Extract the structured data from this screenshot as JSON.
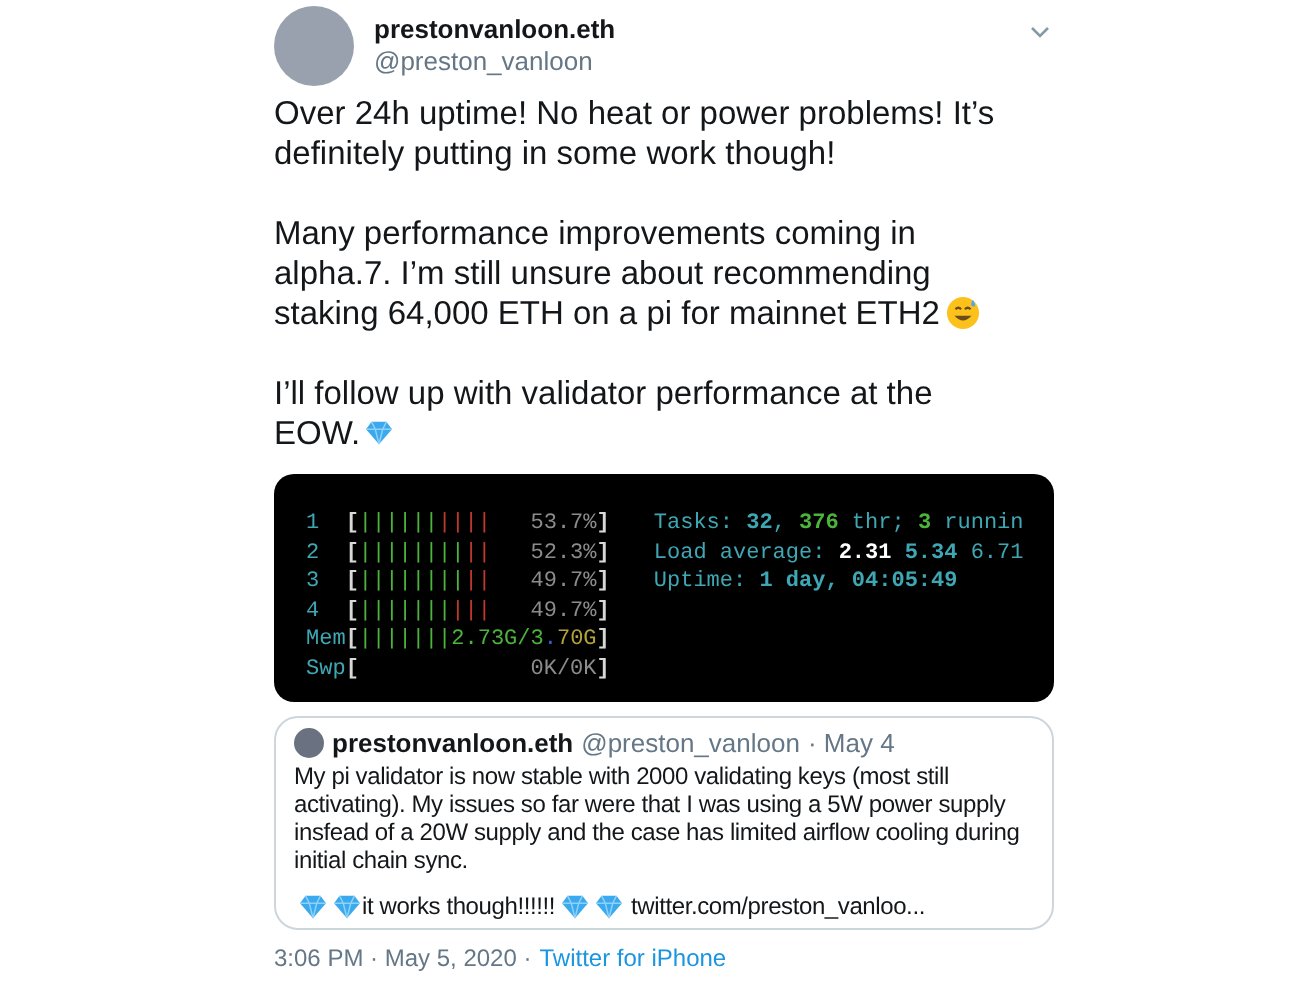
{
  "author": {
    "name": "prestonvanloon.eth",
    "handle": "@preston_vanloon"
  },
  "paragraphs": [
    {
      "text": "Over 24h uptime! No heat or power problems! It’s definitely putting in some work though!",
      "kind": "plain"
    },
    {
      "text": "Many performance improvements coming in alpha.7. I’m still unsure about recommending staking 64,000 ETH on a pi for mainnet ETH2",
      "kind": "smile"
    },
    {
      "text": "I’ll follow up with validator performance at the EOW.",
      "kind": "diamond"
    }
  ],
  "terminal": {
    "left": [
      [
        {
          "text": "1  ",
          "kind": "label"
        },
        {
          "text": "[",
          "kind": "bracket"
        },
        {
          "text": "||||||",
          "kind": "green"
        },
        {
          "text": "||||",
          "kind": "red"
        },
        {
          "text": "   53.7%",
          "kind": "dim"
        },
        {
          "text": "]",
          "kind": "bracket"
        }
      ],
      [
        {
          "text": "2  ",
          "kind": "label"
        },
        {
          "text": "[",
          "kind": "bracket"
        },
        {
          "text": "||||||||",
          "kind": "green"
        },
        {
          "text": "||",
          "kind": "red"
        },
        {
          "text": "   52.3%",
          "kind": "dim"
        },
        {
          "text": "]",
          "kind": "bracket"
        }
      ],
      [
        {
          "text": "3  ",
          "kind": "label"
        },
        {
          "text": "[",
          "kind": "bracket"
        },
        {
          "text": "||||||||",
          "kind": "green"
        },
        {
          "text": "||",
          "kind": "red"
        },
        {
          "text": "   49.7%",
          "kind": "dim"
        },
        {
          "text": "]",
          "kind": "bracket"
        }
      ],
      [
        {
          "text": "4  ",
          "kind": "label"
        },
        {
          "text": "[",
          "kind": "bracket"
        },
        {
          "text": "|||||||",
          "kind": "green"
        },
        {
          "text": "|||",
          "kind": "red"
        },
        {
          "text": "   49.7%",
          "kind": "dim"
        },
        {
          "text": "]",
          "kind": "bracket"
        }
      ],
      [
        {
          "text": "Mem",
          "kind": "label"
        },
        {
          "text": "[",
          "kind": "bracket"
        },
        {
          "text": "|||||||",
          "kind": "green"
        },
        {
          "text": "2.73G/3",
          "kind": "green"
        },
        {
          "text": ".",
          "kind": "blue"
        },
        {
          "text": "70G",
          "kind": "yellow"
        },
        {
          "text": "]",
          "kind": "bracket"
        }
      ],
      [
        {
          "text": "Swp",
          "kind": "label"
        },
        {
          "text": "[",
          "kind": "bracket"
        },
        {
          "text": "             0K/0K",
          "kind": "dim"
        },
        {
          "text": "]",
          "kind": "bracket"
        }
      ]
    ],
    "right": [
      [
        {
          "text": "Tasks: ",
          "kind": "label"
        },
        {
          "text": "32",
          "kind": "cyanbold"
        },
        {
          "text": ", ",
          "kind": "label"
        },
        {
          "text": "376",
          "kind": "greenbold"
        },
        {
          "text": " thr; ",
          "kind": "label"
        },
        {
          "text": "3",
          "kind": "greenbold"
        },
        {
          "text": " runnin",
          "kind": "label"
        }
      ],
      [
        {
          "text": "Load average: ",
          "kind": "label"
        },
        {
          "text": "2.31",
          "kind": "white"
        },
        {
          "text": " 5.34 ",
          "kind": "cyanbold"
        },
        {
          "text": "6.71",
          "kind": "label"
        }
      ],
      [
        {
          "text": "Uptime: ",
          "kind": "label"
        },
        {
          "text": "1 day, 04:05:49",
          "kind": "cyanbold"
        }
      ]
    ]
  },
  "quote": {
    "name": "prestonvanloon.eth",
    "handle": "@preston_vanloon",
    "date": "· May 4",
    "text": "My pi validator is now stable with 2000 validating keys (most still activating). My issues so far were that I was using a 5W power supply insfead of a 20W supply and the case has limited airflow cooling during initial chain sync.",
    "last_line": "it works though!!!!!!",
    "link": "twitter.com/preston_vanloo..."
  },
  "footer": {
    "time": "3:06 PM · May 5, 2020 ·",
    "source": "Twitter for iPhone"
  }
}
